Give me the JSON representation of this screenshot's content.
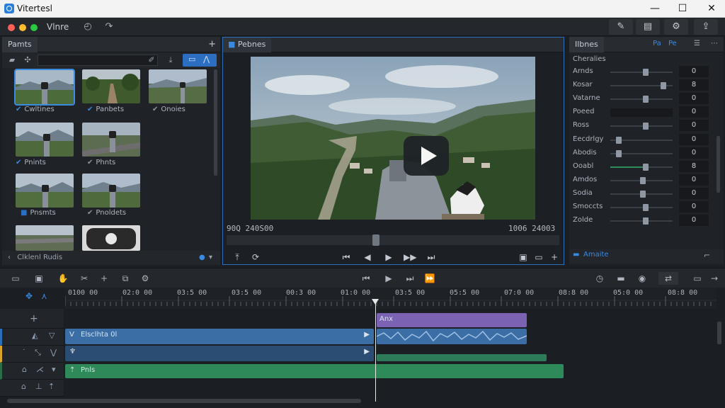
{
  "window": {
    "title": "Vitertesl"
  },
  "menubar": {
    "app_name": "Vlnre"
  },
  "media": {
    "tab": "Pamts",
    "items": [
      {
        "label": "Cwltines"
      },
      {
        "label": "Panbets"
      },
      {
        "label": "Onoies"
      },
      {
        "label": "Pnints"
      },
      {
        "label": "Phnts"
      },
      {
        "label": "Pnsmts"
      },
      {
        "label": "Pnoldets"
      }
    ],
    "footer": "Clklenl Rudis"
  },
  "preview": {
    "tab": "Pebnes",
    "timecode_left": "90Q 240S00",
    "timecode_right": "1006 24003"
  },
  "properties": {
    "tab": "Ilbnes",
    "header_links": [
      "Pa",
      "Pe"
    ],
    "section": "Cheralies",
    "rows": [
      {
        "label": "Arnds",
        "value": "0",
        "pos": 0.55
      },
      {
        "label": "Kosar",
        "value": "8",
        "pos": 0.85
      },
      {
        "label": "Vatarne",
        "value": "0",
        "pos": 0.55
      },
      {
        "label": "Poeed",
        "value": "0",
        "pos": null
      },
      {
        "label": "Ross",
        "value": "0",
        "pos": 0.55
      },
      {
        "label": "Eecdrlgy",
        "value": "0",
        "pos": 0.1
      },
      {
        "label": "Abodis",
        "value": "0",
        "pos": 0.1
      },
      {
        "label": "Ooabl",
        "value": "8",
        "pos": 0.55
      },
      {
        "label": "Amdos",
        "value": "0",
        "pos": 0.5
      },
      {
        "label": "Sodia",
        "value": "0",
        "pos": 0.5
      },
      {
        "label": "Smoccts",
        "value": "0",
        "pos": 0.55
      },
      {
        "label": "Zolde",
        "value": "0",
        "pos": 0.55
      }
    ],
    "footer": "Amaite"
  },
  "timeline": {
    "ruler": [
      "0100 00",
      "02:0 00",
      "03:5 00",
      "03:5 00",
      "00:3 00",
      "01:0 00",
      "03:5 00",
      "05:5 00",
      "07:0 00",
      "08:8 00",
      "05:0 00",
      "08:8 00"
    ],
    "clips": {
      "music": "Anx",
      "video": "Elsclhta 0l",
      "audio": "Pnls"
    }
  },
  "colors": {
    "accent": "#2c6fc2",
    "video_clip": "#3a6ea5",
    "music_clip": "#7b62b3",
    "audio_clip": "#2f8a59"
  }
}
